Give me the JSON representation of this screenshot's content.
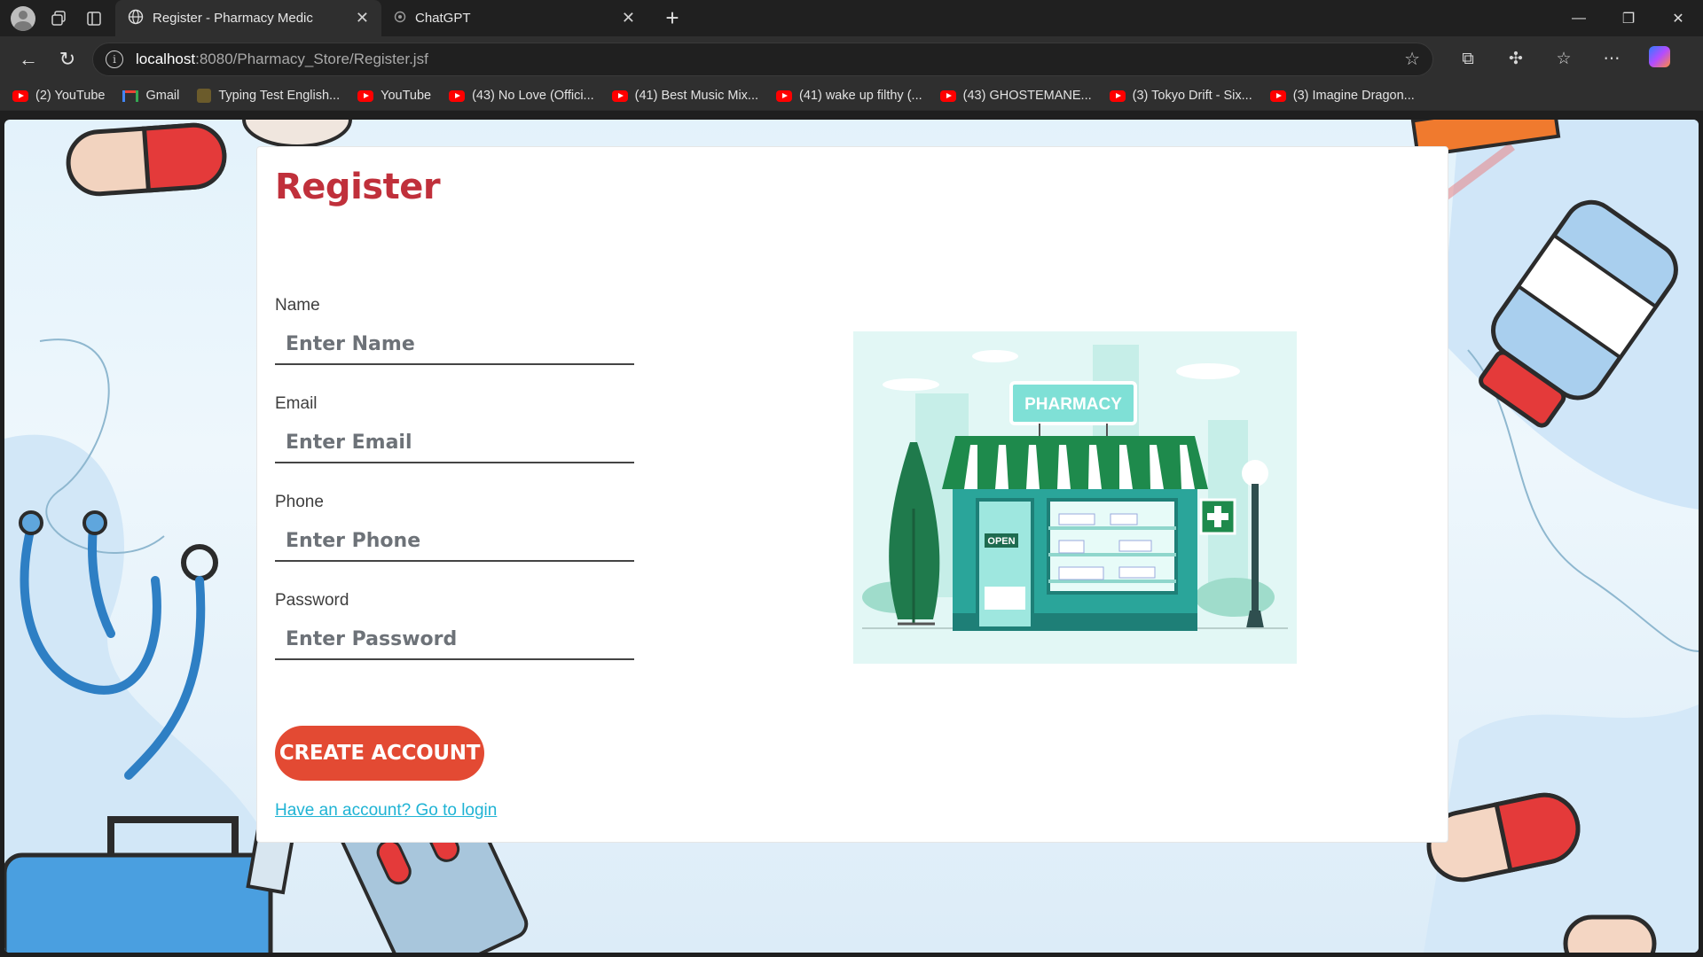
{
  "browser": {
    "tabs": [
      {
        "title": "Register - Pharmacy Medic",
        "active": true
      },
      {
        "title": "ChatGPT",
        "active": false
      }
    ],
    "url": {
      "host": "localhost",
      "path": ":8080/Pharmacy_Store/Register.jsf"
    },
    "bookmarks": [
      {
        "label": "(2) YouTube",
        "icon": "youtube-icon"
      },
      {
        "label": "Gmail",
        "icon": "gmail-icon"
      },
      {
        "label": "Typing Test English...",
        "icon": "typing-icon"
      },
      {
        "label": "YouTube",
        "icon": "youtube-icon"
      },
      {
        "label": "(43) No Love (Offici...",
        "icon": "youtube-icon"
      },
      {
        "label": "(41) Best Music Mix...",
        "icon": "youtube-icon"
      },
      {
        "label": "(41) wake up filthy (...",
        "icon": "youtube-icon"
      },
      {
        "label": "(43) GHOSTEMANE...",
        "icon": "youtube-icon"
      },
      {
        "label": "(3) Tokyo Drift - Six...",
        "icon": "youtube-icon"
      },
      {
        "label": "(3) Imagine Dragon...",
        "icon": "youtube-icon"
      }
    ]
  },
  "page": {
    "title": "Register",
    "fields": [
      {
        "label": "Name",
        "placeholder": "Enter Name"
      },
      {
        "label": "Email",
        "placeholder": "Enter Email"
      },
      {
        "label": "Phone",
        "placeholder": "Enter Phone"
      },
      {
        "label": "Password",
        "placeholder": "Enter Password"
      }
    ],
    "submit_label": "CREATE ACCOUNT",
    "login_link": "Have an account? Go to login",
    "illustration": {
      "sign": "PHARMACY",
      "door_sign": "OPEN"
    }
  },
  "colors": {
    "title": "#c0303b",
    "button": "#e34a33",
    "link": "#1fb3d4",
    "awning_green": "#1e8a4c",
    "storefront_teal": "#2aa59a"
  }
}
